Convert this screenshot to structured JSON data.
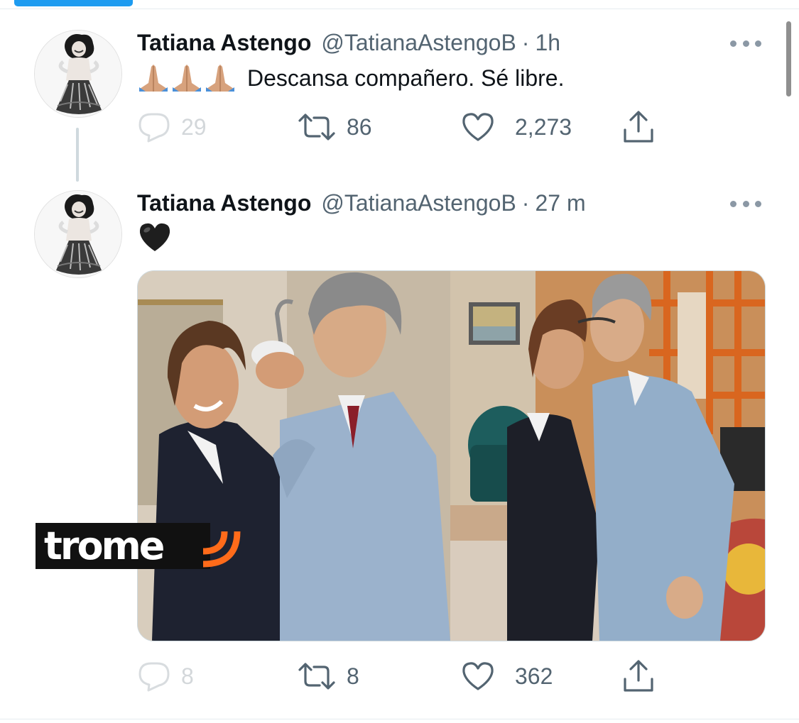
{
  "tweets": [
    {
      "author_name": "Tatiana Astengo",
      "handle": "@TatianaAstengoB",
      "time": "1h",
      "emoji_prefix": [
        "pray-emoji",
        "pray-emoji",
        "pray-emoji"
      ],
      "text": "Descansa compañero. Sé libre.",
      "stats": {
        "replies": "29",
        "retweets": "86",
        "likes": "2,273"
      }
    },
    {
      "author_name": "Tatiana Astengo",
      "handle": "@TatianaAstengoB",
      "time": "27 m",
      "emoji": "black-heart-emoji",
      "media": {
        "description": "Two couples in business suits dancing in a living room",
        "watermark": "trome"
      },
      "stats": {
        "replies": "8",
        "retweets": "8",
        "likes": "362"
      }
    }
  ],
  "separator": "·",
  "colors": {
    "accent": "#1d9bf0",
    "text": "#0f1419",
    "secondary": "#536471",
    "thread_line": "#cfd9de",
    "watermark_orange": "#ff6b1a"
  },
  "icons": {
    "reply": "reply-icon",
    "retweet": "retweet-icon",
    "like": "heart-icon",
    "share": "share-icon",
    "more": "more-icon"
  }
}
